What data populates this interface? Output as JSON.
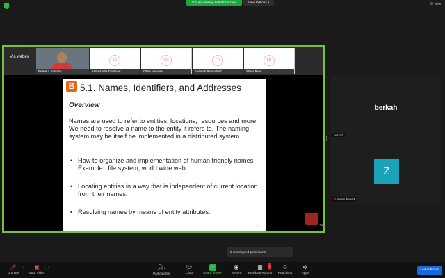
{
  "top_bar": {
    "sharing_banner": "You are viewing berkah's screen",
    "view_options": "View Options ▾",
    "view_label": "View"
  },
  "share": {
    "webex_label": "Via webex",
    "thumbnails": [
      {
        "name": "Berkah I. Santoso",
        "initials": ""
      },
      {
        "name": "Ahmad Azfa Dzulfaqar",
        "initials": "AD"
      },
      {
        "name": "Chika Humaira",
        "initials": "CH"
      },
      {
        "name": "Faatihah Rahmatillah",
        "initials": "FR"
      },
      {
        "name": "Sheila Riva",
        "initials": "SR"
      }
    ],
    "slide": {
      "logo_letter": "B",
      "title": "5.1. Names, Identifiers, and Addresses",
      "subtitle": "Overview",
      "paragraph": "Names are used to refer to entities, locations, resources and more. We need to resolve a name to the entity it refers to. The naming system may be itself be implemented in a distributed system.",
      "bullets": [
        "How to organize and implementation of human friendly names. Example : file system, world wide web.",
        "Locating entities in a way that is independent of current location from their names.",
        "Resolving names by means of entity attributes."
      ],
      "page": "2"
    },
    "small_count": "+2"
  },
  "right_panel": {
    "tile1_name": "berkah",
    "tile1_label": "berkah",
    "tile2_initial": "Z",
    "tile2_label": "zoom baa04"
  },
  "toast": "2 unassigned participants",
  "toolbar": {
    "unmute": "Unmute",
    "start_video": "Start Video",
    "participants": "Participants",
    "participants_count": "2",
    "chat": "Chat",
    "share_screen": "Share Screen",
    "record": "Record",
    "breakout_rooms": "Breakout Rooms",
    "breakout_badge": "2",
    "reactions": "Reactions",
    "apps": "Apps",
    "leave": "Leave Room"
  },
  "colors": {
    "share_border": "#75c23a",
    "share_button": "#23b445",
    "leave_button": "#1769e0",
    "avatar_z": "#1aa3b8"
  }
}
